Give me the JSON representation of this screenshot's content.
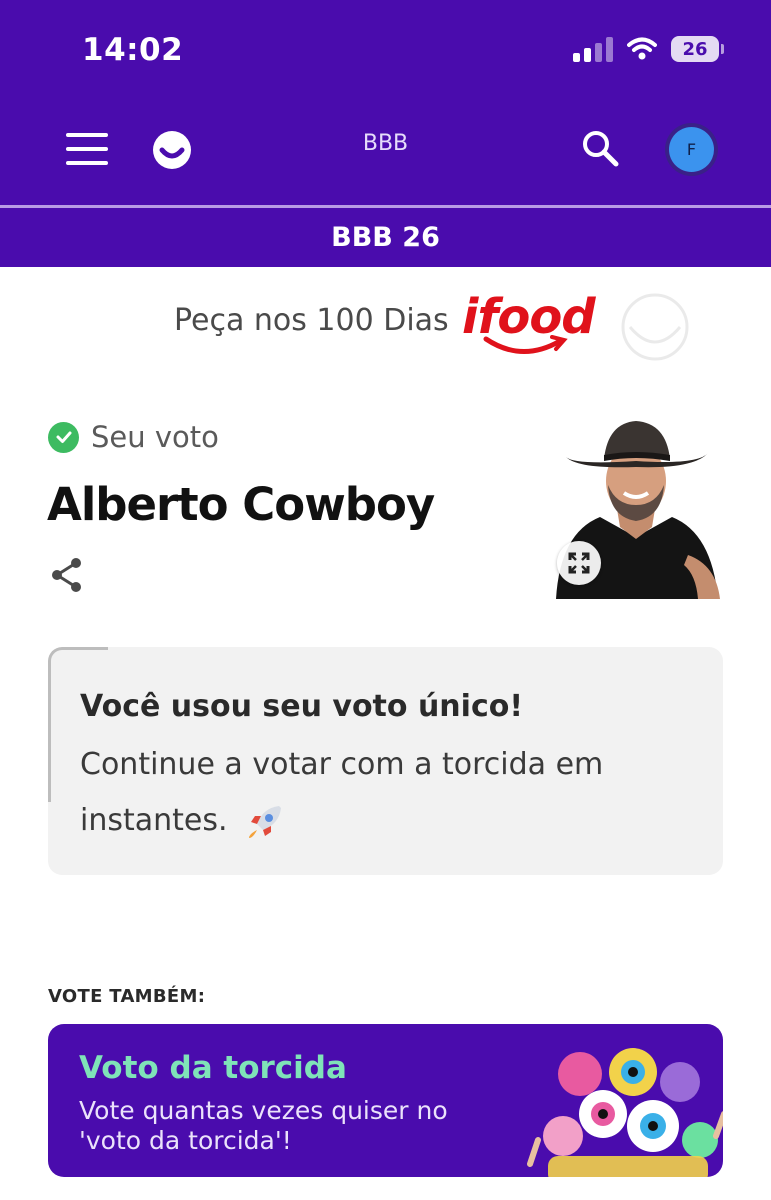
{
  "status_bar": {
    "time": "14:02",
    "battery": "26"
  },
  "header": {
    "brand_title": "BBB",
    "avatar_initial": "F"
  },
  "subheader": {
    "title": "BBB 26"
  },
  "ad": {
    "text": "Peça nos 100 Dias",
    "logo_text": "ifood"
  },
  "vote": {
    "status_label": "Seu voto",
    "candidate_name": "Alberto Cowboy"
  },
  "info_card": {
    "heading": "Você usou seu voto único!",
    "body": "Continue a votar com a torcida em instantes."
  },
  "vote_also": {
    "label": "VOTE TAMBÉM:",
    "card_title": "Voto da torcida",
    "card_description": "Vote quantas vezes quiser no 'voto da torcida'!"
  },
  "colors": {
    "header_purple": "#4a0cad",
    "accent_green": "#7fe3b8",
    "check_green": "#3dbb61",
    "ifood_red": "#e0121b"
  },
  "icons": [
    "menu-icon",
    "globo-logo-icon",
    "search-icon",
    "check-circle-icon",
    "share-icon",
    "expand-icon",
    "rocket-icon"
  ]
}
